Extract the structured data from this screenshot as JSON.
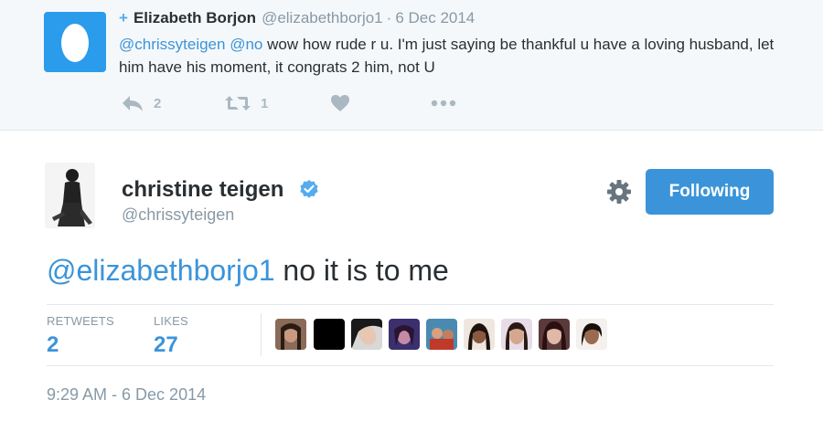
{
  "reply_tweet": {
    "follow_symbol": "+",
    "name": "Elizabeth Borjon",
    "handle": "@elizabethborjo1",
    "separator": "·",
    "date": "6 Dec 2014",
    "mention1": "@chrissyteigen",
    "mention2": "@no",
    "text": " wow how rude r u. I'm just saying be thankful u have a loving husband, let him have his moment, it congrats 2 him, not U",
    "reply_count": "2",
    "retweet_count": "1"
  },
  "main_tweet": {
    "name": "christine teigen",
    "handle": "@chrissyteigen",
    "follow_button": "Following",
    "mention": "@elizabethborjo1",
    "text": " no it is to me",
    "retweets_label": "RETWEETS",
    "retweets_value": "2",
    "likes_label": "LIKES",
    "likes_value": "27",
    "timestamp": "9:29 AM - 6 Dec 2014"
  },
  "colors": {
    "link": "#3b94d9",
    "muted": "#8899a6",
    "button": "#3b94d9",
    "egg_avatar": "#2b9bec",
    "reply_bg": "#f5f8fa"
  },
  "icons": [
    "egg-avatar-icon",
    "reply-icon",
    "retweet-icon",
    "heart-icon",
    "more-icon",
    "verified-badge-icon",
    "gear-icon"
  ]
}
